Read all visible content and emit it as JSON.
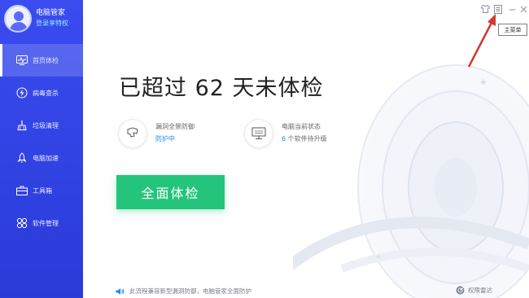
{
  "profile": {
    "name": "电脑管家",
    "link": "登录享特权"
  },
  "sidebar": {
    "items": [
      {
        "label": "首页体检",
        "icon": "pulse-monitor-icon",
        "active": true
      },
      {
        "label": "病毒查杀",
        "icon": "lightning-shield-icon",
        "active": false
      },
      {
        "label": "垃圾清理",
        "icon": "broom-icon",
        "active": false
      },
      {
        "label": "电脑加速",
        "icon": "rocket-icon",
        "active": false
      },
      {
        "label": "工具箱",
        "icon": "toolbox-icon",
        "active": false
      },
      {
        "label": "软件管理",
        "icon": "apps-grid-icon",
        "active": false
      }
    ]
  },
  "window": {
    "tooltip": "主菜单",
    "controls": [
      "skin-icon",
      "menu-icon",
      "minimize-icon",
      "close-icon"
    ]
  },
  "main": {
    "headline": "已超过 62 天未体检",
    "protection": {
      "title": "漏洞全景防御",
      "status": "防护中"
    },
    "pc_state": {
      "title": "电脑当前状态",
      "count": "6",
      "status_rest": "个软件待升级"
    },
    "scan_button": "全面体检"
  },
  "footer": {
    "tip": "此流程兼容新型漏洞防御，电脑管家全面防护",
    "right_label": "权限雷达"
  },
  "colors": {
    "sidebar": "#3344e6",
    "accent_green": "#25c47d",
    "accent_blue": "#1f8be6",
    "arrow_red": "#d03a2f"
  }
}
